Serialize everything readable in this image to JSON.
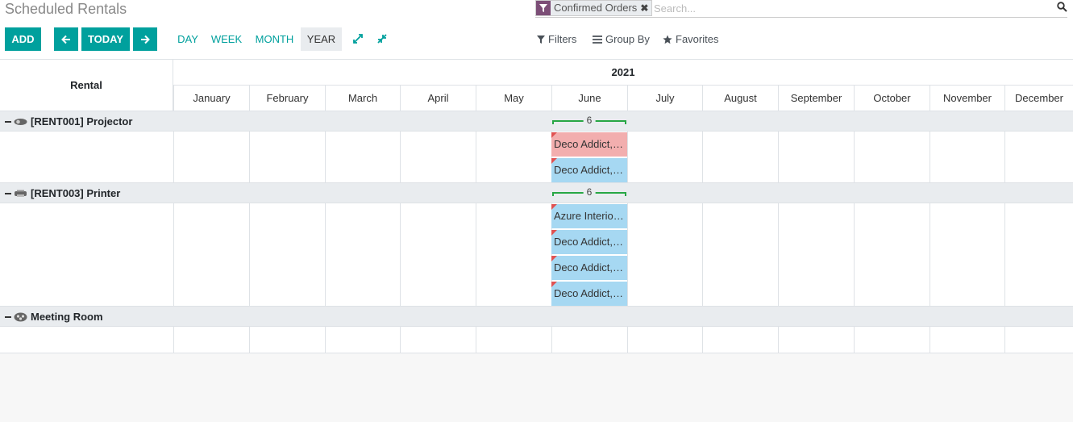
{
  "page": {
    "title": "Scheduled Rentals"
  },
  "search": {
    "facet_value": "Confirmed Orders",
    "placeholder": "Search..."
  },
  "toolbar": {
    "add_label": "ADD",
    "today_label": "TODAY",
    "scales": [
      "DAY",
      "WEEK",
      "MONTH",
      "YEAR"
    ],
    "active_scale": "YEAR",
    "filters_label": "Filters",
    "group_by_label": "Group By",
    "favorites_label": "Favorites"
  },
  "gantt": {
    "row_header_label": "Rental",
    "year": "2021",
    "months": [
      "January",
      "February",
      "March",
      "April",
      "May",
      "June",
      "July",
      "August",
      "September",
      "October",
      "November",
      "December"
    ],
    "groups": [
      {
        "name": "[RENT001] Projector",
        "count": "6",
        "pills": [
          {
            "label": "Deco Addict, S...",
            "color": "#f2aeae"
          },
          {
            "label": "Deco Addict, S...",
            "color": "#a6d8f2"
          }
        ]
      },
      {
        "name": "[RENT003] Printer",
        "count": "6",
        "pills": [
          {
            "label": "Azure Interior, ...",
            "color": "#a6d8f2"
          },
          {
            "label": "Deco Addict, S...",
            "color": "#a6d8f2"
          },
          {
            "label": "Deco Addict, S...",
            "color": "#a6d8f2"
          },
          {
            "label": "Deco Addict, S...",
            "color": "#a6d8f2"
          }
        ]
      },
      {
        "name": "Meeting Room",
        "count": "",
        "pills": []
      }
    ]
  },
  "colors": {
    "accent": "#00a09d",
    "facet": "#7c4e77",
    "warning_corner": "#e05252",
    "group_bar": "#28a745"
  }
}
